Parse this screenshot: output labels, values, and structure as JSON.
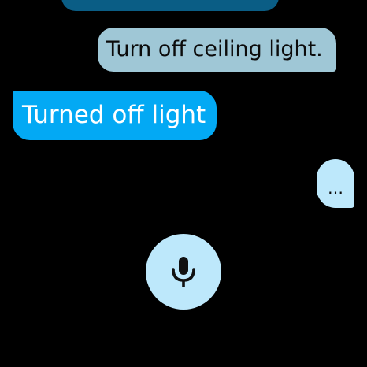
{
  "conversation": {
    "user_message": "Turn off ceiling light.",
    "assistant_reply": "Turned off light",
    "typing_indicator": "…"
  },
  "mic": {
    "icon": "microphone-icon"
  },
  "colors": {
    "background": "#000000",
    "previous_bubble": "#0a5d85",
    "user_bubble": "#9fc7d6",
    "assistant_bubble": "#03a9f4",
    "typing_bubble": "#bde8fb",
    "mic_button": "#bde8fb"
  }
}
